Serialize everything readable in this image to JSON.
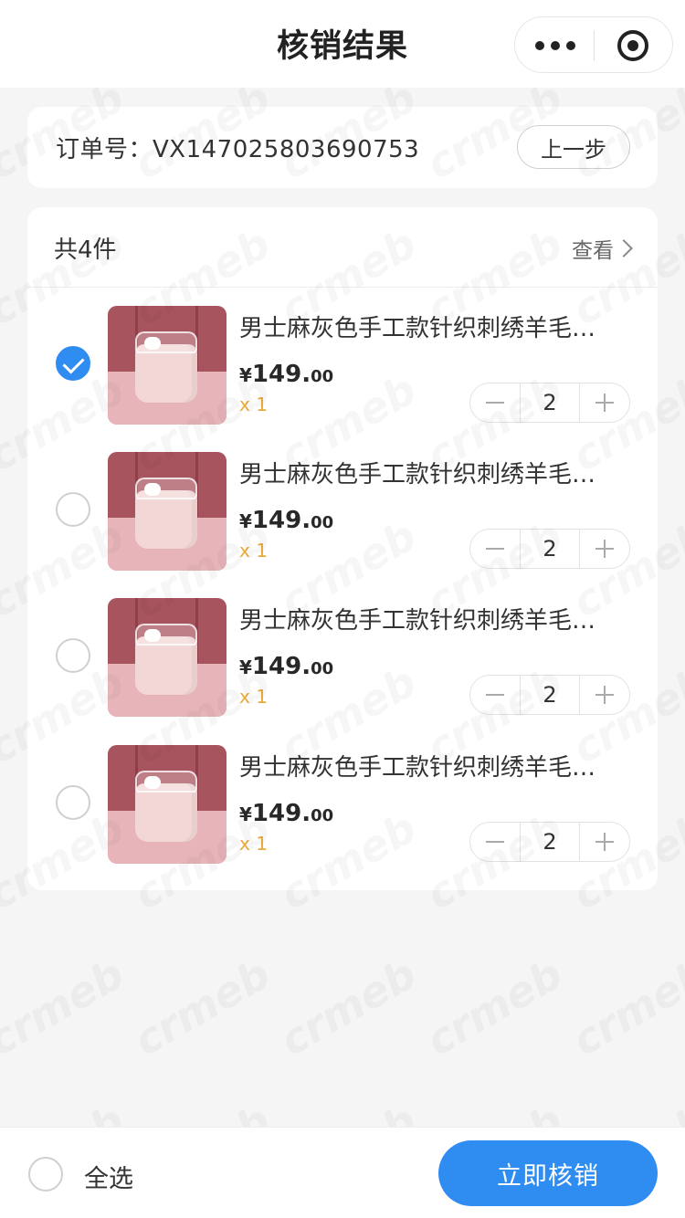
{
  "navbar": {
    "title": "核销结果"
  },
  "order": {
    "label": "订单号：VX147025803690753",
    "prev_button": "上一步"
  },
  "goods": {
    "total_label": "共4件",
    "view_label": "查看",
    "items": [
      {
        "name": "男士麻灰色手工款针织刺绣羊毛…",
        "currency": "¥",
        "price_int": "149.",
        "price_dec": "00",
        "qty_label": "x 1",
        "count": "2",
        "selected": true
      },
      {
        "name": "男士麻灰色手工款针织刺绣羊毛…",
        "currency": "¥",
        "price_int": "149.",
        "price_dec": "00",
        "qty_label": "x 1",
        "count": "2",
        "selected": false
      },
      {
        "name": "男士麻灰色手工款针织刺绣羊毛…",
        "currency": "¥",
        "price_int": "149.",
        "price_dec": "00",
        "qty_label": "x 1",
        "count": "2",
        "selected": false
      },
      {
        "name": "男士麻灰色手工款针织刺绣羊毛…",
        "currency": "¥",
        "price_int": "149.",
        "price_dec": "00",
        "qty_label": "x 1",
        "count": "2",
        "selected": false
      }
    ]
  },
  "footer": {
    "select_all_label": "全选",
    "verify_button": "立即核销"
  },
  "watermark_text": "crmeb",
  "colors": {
    "accent": "#2f8cf0",
    "qty": "#e9a93b",
    "background": "#f5f5f5"
  }
}
